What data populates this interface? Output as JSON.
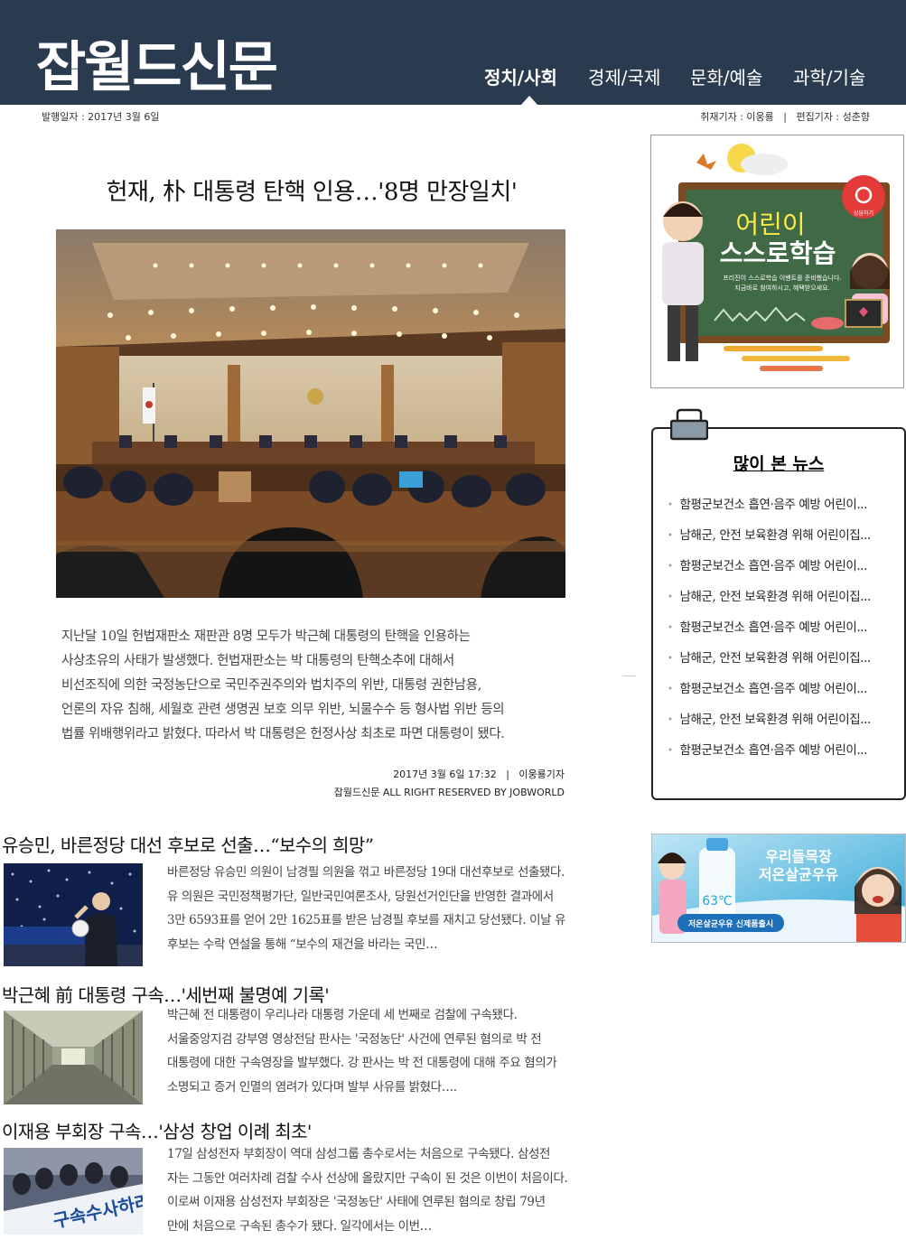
{
  "header": {
    "logo": "잡월드신문",
    "nav": [
      "정치/사회",
      "경제/국제",
      "문화/예술",
      "과학/기술"
    ],
    "active_index": 0
  },
  "meta": {
    "publish_date": "발행일자 : 2017년 3월 6일",
    "reporters": "취재기자 : 이웅룡   |   편집기자 : 성춘향"
  },
  "main_article": {
    "headline": "헌재, 朴 대통령 탄핵 인용…'8명 만장일치'",
    "body": [
      "지난달 10일 헌법재판소 재판관 8명 모두가 박근혜 대통령의 탄핵을 인용하는",
      "사상초유의 사태가 발생했다. 헌법재판소는 박 대통령의 탄핵소추에 대해서",
      "비선조직에 의한 국정농단으로 국민주권주의와 법치주의 위반, 대통령 권한남용,",
      "언론의 자유 침해, 세월호 관련 생명권 보호 의무 위반, 뇌물수수 등 형사법 위반 등의",
      "법률 위배행위라고 밝혔다. 따라서 박 대통령은 헌정사상 최초로 파면 대통령이 됐다."
    ],
    "byline_1": "2017년 3월 6일 17:32   |   이웅룡기자",
    "byline_2": "잡월드신문  ALL RIGHT RESERVED BY JOBWORLD"
  },
  "sidebar": {
    "ad1": {
      "title_1": "어린이",
      "title_2": "스스로학습",
      "desc_1": "프리진이 스스로학습 이벤트를 준비했습니다.",
      "desc_2": "지금바로 참여하시고, 혜택받으세요.",
      "badge": "상담하기"
    },
    "popular": {
      "title": "많이 본 뉴스",
      "items": [
        "함평군보건소 흡연·음주 예방 어린이...",
        "남해군, 안전 보육환경 위해 어린이집...",
        "함평군보건소 흡연·음주 예방 어린이...",
        "남해군, 안전 보육환경 위해 어린이집...",
        "함평군보건소 흡연·음주 예방 어린이...",
        "남해군, 안전 보육환경 위해 어린이집...",
        "함평군보건소 흡연·음주 예방 어린이...",
        "남해군, 안전 보육환경 위해 어린이집...",
        "함평군보건소 흡연·음주 예방 어린이..."
      ]
    },
    "ad2": {
      "line_1": "우리들목장",
      "line_2": "저온살균우유",
      "bottle_label": "63℃",
      "cta": "저온살균우유 신제품출시"
    }
  },
  "sub_articles": [
    {
      "title": "유승민, 바른정당 대선 후보로 선출…“보수의 희망”",
      "lines": [
        "바른정당 유승민 의원이 남경필 의원을 꺾고 바른정당 19대 대선후보로 선출됐다.",
        "유 의원은 국민정책평가단, 일반국민여론조사, 당원선거인단을 반영한 결과에서",
        "3만 6593표를 얻어 2만 1625표를 받은 남경필 후보를 재치고 당선됐다. 이날 유",
        "후보는 수락 연설을 통해 “보수의 재건을 바라는 국민…"
      ]
    },
    {
      "title": "박근혜 前 대통령 구속…'세번째 불명예 기록'",
      "lines": [
        "박근혜 전 대통령이 우리나라 대통령 가운데 세 번째로 검찰에 구속됐다.",
        "서울중앙지검 강부영 영상전담 판사는 '국정농단' 사건에 연루된 혐의로 박 전",
        "대통령에 대한 구속영장을 발부했다. 강 판사는 박 전 대통령에 대해 주요 혐의가",
        "소명되고 증거 인멸의 염려가 있다며 발부 사유를 밝혔다…."
      ]
    },
    {
      "title": "이재용 부회장 구속…'삼성 창업 이례 최초'",
      "lines": [
        "17일 삼성전자 부회장이 역대 삼성그룹 총수로서는 처음으로 구속됐다. 삼성전",
        "자는 그동안 여러차례 검찰 수사 선상에 올랐지만 구속이 된 것은 이번이 처음이다.",
        "이로써 이재용 삼성전자 부회장은 '국정농단' 사태에 연루된 혐의로 창립 79년",
        "만에 처음으로 구속된 총수가 됐다. 일각에서는 이번…"
      ],
      "thumb_banner": "구속수사하라!"
    }
  ]
}
